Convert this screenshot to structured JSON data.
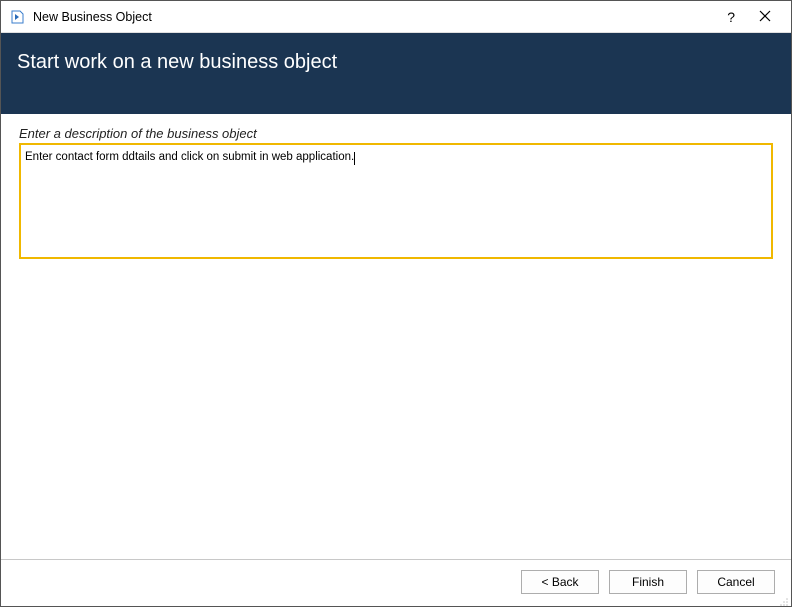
{
  "window": {
    "title": "New Business Object"
  },
  "banner": {
    "heading": "Start work on a new business object"
  },
  "form": {
    "description_label": "Enter a description of the business object",
    "description_value": "Enter contact form ddtails and click on submit in web application."
  },
  "footer": {
    "back_label": "< Back",
    "finish_label": "Finish",
    "cancel_label": "Cancel"
  }
}
